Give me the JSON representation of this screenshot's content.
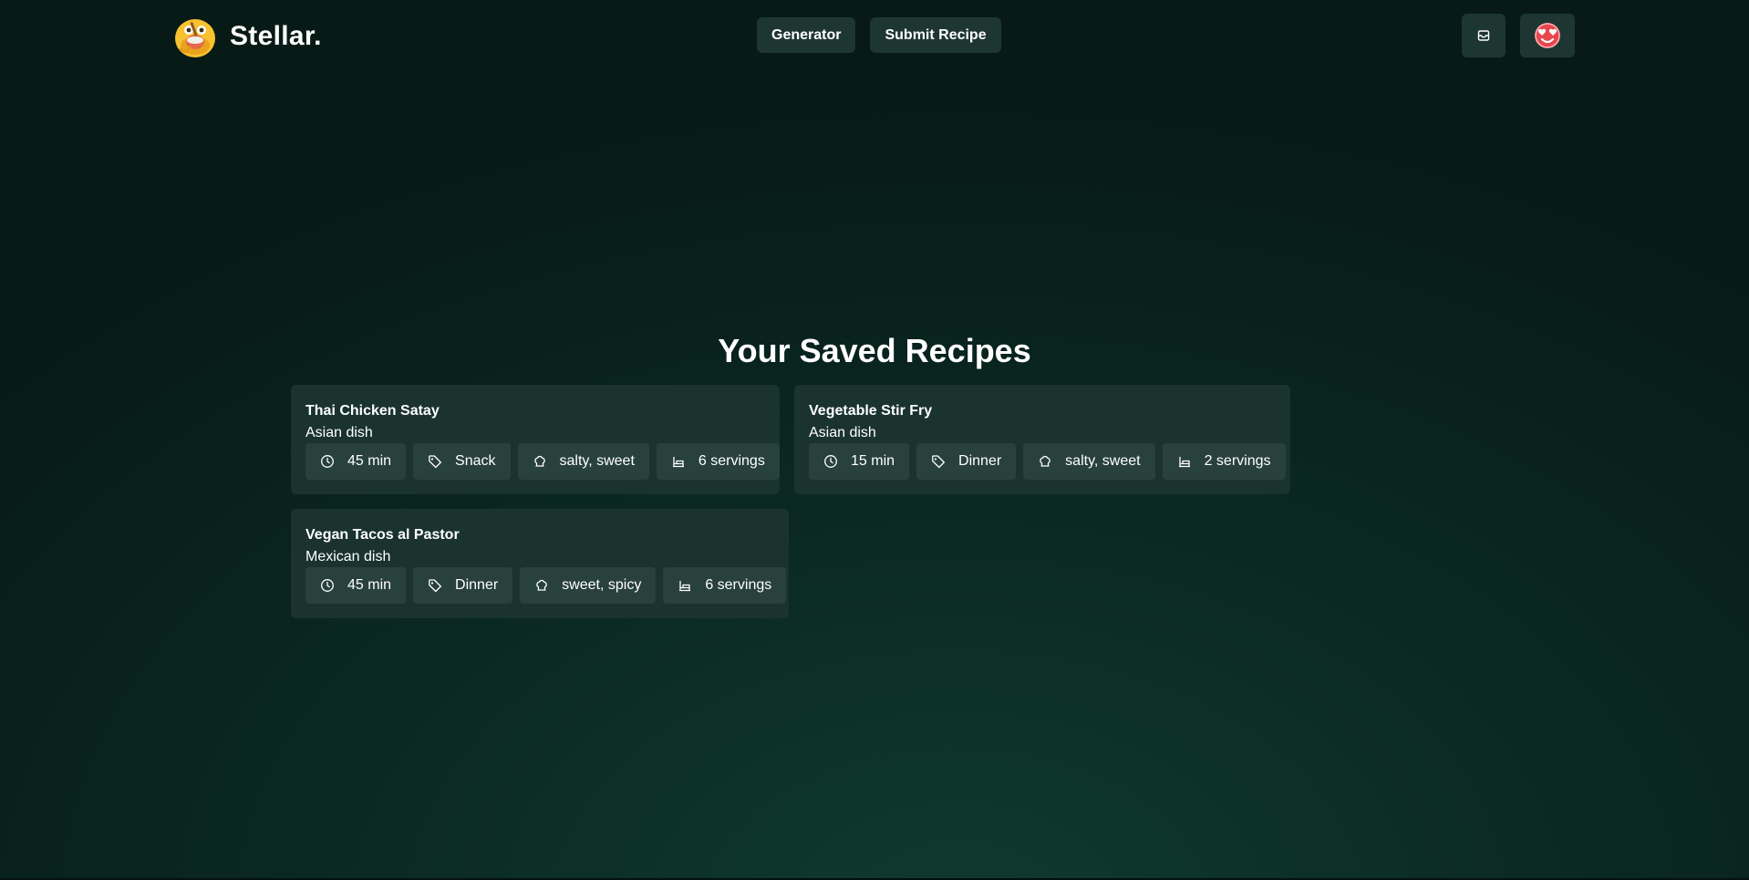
{
  "brand": {
    "name": "Stellar."
  },
  "nav": {
    "generator": "Generator",
    "submit_recipe": "Submit Recipe"
  },
  "header_icons": {
    "inbox": "inbox-icon",
    "avatar": "heart-face-avatar"
  },
  "main": {
    "title": "Your Saved Recipes",
    "recipes": [
      {
        "name": "Thai Chicken Satay",
        "cuisine": "Asian dish",
        "time": "45 min",
        "meal": "Snack",
        "flavor": "salty, sweet",
        "servings": "6 servings"
      },
      {
        "name": "Vegetable Stir Fry",
        "cuisine": "Asian dish",
        "time": "15 min",
        "meal": "Dinner",
        "flavor": "salty, sweet",
        "servings": "2 servings"
      },
      {
        "name": "Vegan Tacos al Pastor",
        "cuisine": "Mexican dish",
        "time": "45 min",
        "meal": "Dinner",
        "flavor": "sweet, spicy",
        "servings": "6 servings"
      }
    ]
  },
  "colors": {
    "background": "#0b2a23",
    "card": "#1a332f",
    "tag": "#28413d",
    "button": "#1e3632",
    "logo_yellow": "#f7c22e",
    "avatar_red": "#e8464e"
  }
}
